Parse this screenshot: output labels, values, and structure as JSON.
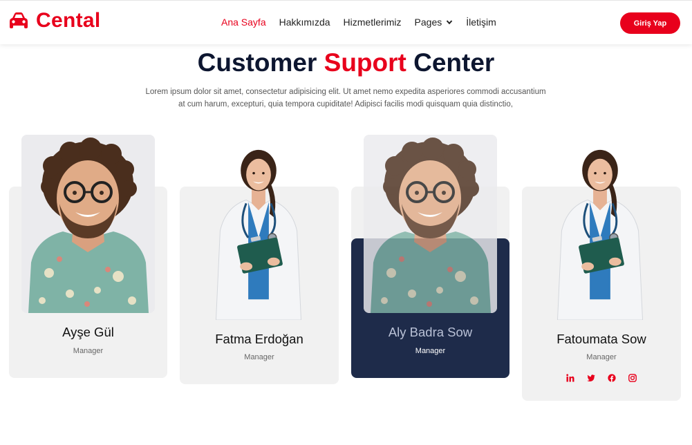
{
  "brand": {
    "name": "Cental",
    "logo_icon": "car-icon",
    "accent": "#e8001c"
  },
  "nav": {
    "items": [
      {
        "label": "Ana Sayfa",
        "active": true
      },
      {
        "label": "Hakkımızda",
        "active": false
      },
      {
        "label": "Hizmetlerimiz",
        "active": false
      },
      {
        "label": "Pages",
        "active": false,
        "dropdown": true
      },
      {
        "label": "İletişim",
        "active": false
      }
    ],
    "login_label": "Giriş Yap"
  },
  "section": {
    "title_part1": "Customer",
    "title_accent": "Suport",
    "title_part2": "Center",
    "description_line1": "Lorem ipsum dolor sit amet, consectetur adipisicing elit. Ut amet nemo expedita asperiores commodi accusantium",
    "description_line2": "at cum harum, excepturi, quia tempora cupiditate! Adipisci facilis modi quisquam quia distinctio,"
  },
  "team": [
    {
      "name": "Ayşe Gül",
      "role": "Manager",
      "photo": "man-portrait"
    },
    {
      "name": "Fatma Erdoğan",
      "role": "Manager",
      "photo": "doctor-portrait"
    },
    {
      "name": "Aly Badra Sow",
      "role": "Manager",
      "photo": "man-portrait",
      "highlighted": true
    },
    {
      "name": "Fatoumata Sow",
      "role": "Manager",
      "photo": "doctor-portrait",
      "socials": [
        "linkedin-icon",
        "twitter-icon",
        "facebook-icon",
        "instagram-icon"
      ]
    }
  ],
  "colors": {
    "dark_card": "#1e2b4a",
    "card_bg": "#f1f1f1",
    "heading": "#0d1630"
  }
}
